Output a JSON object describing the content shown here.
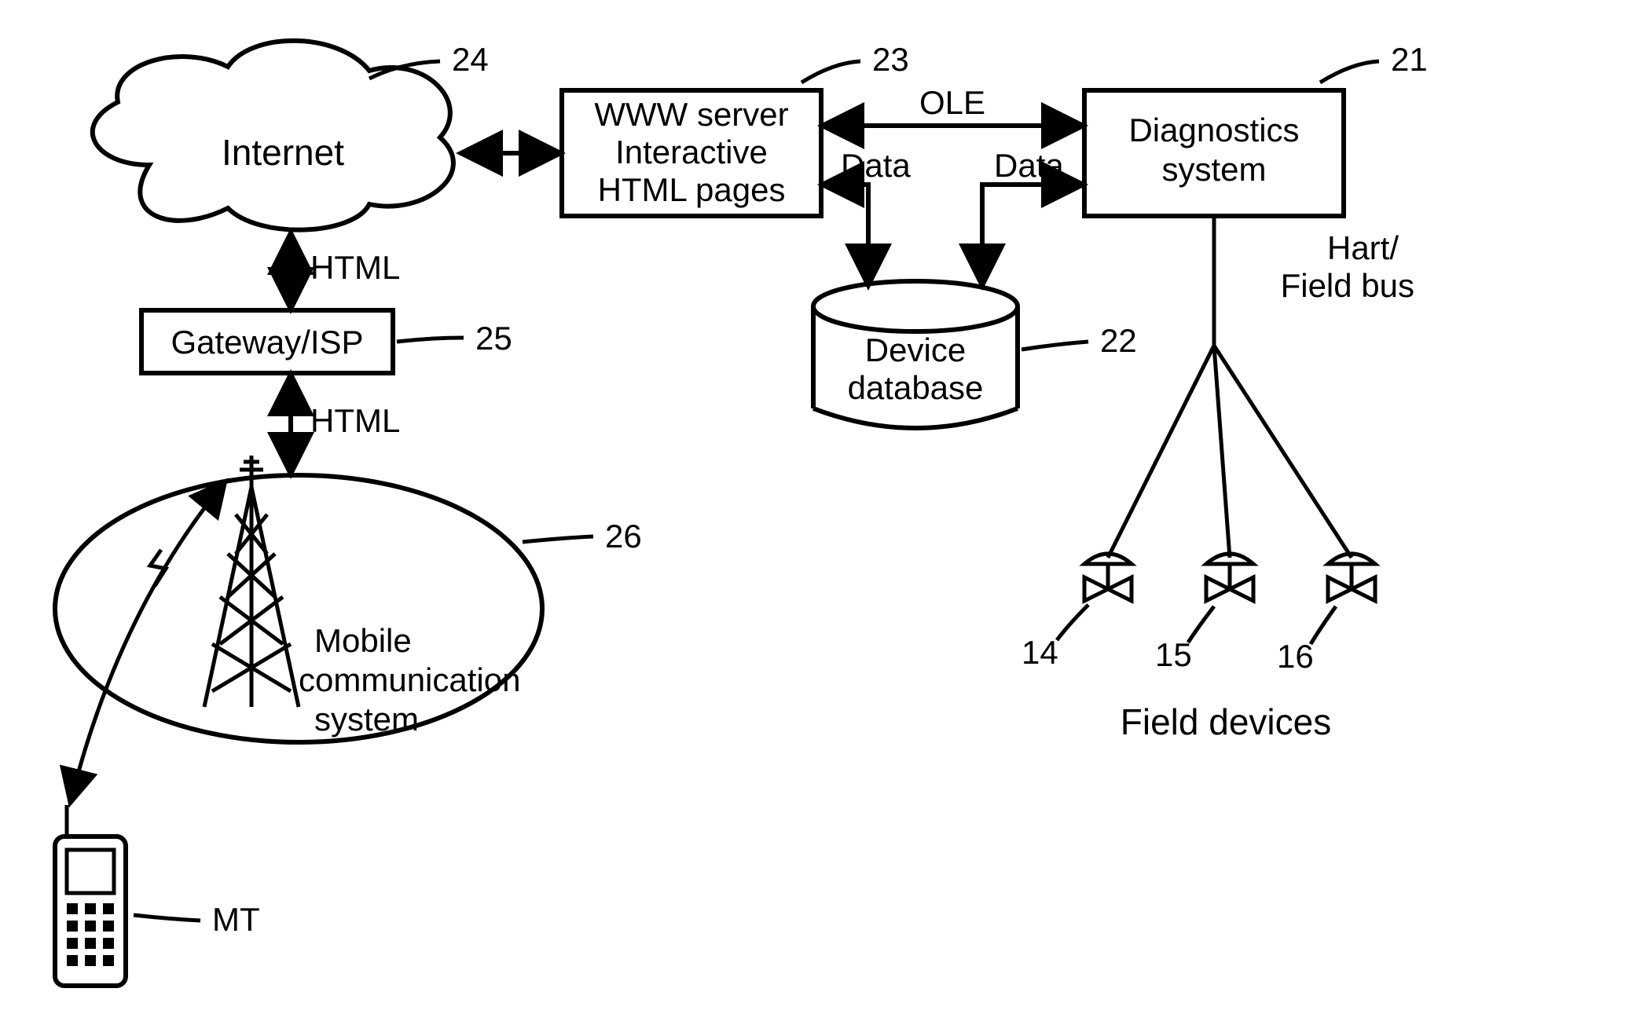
{
  "nodes": {
    "internet": {
      "label": "Internet",
      "ref": "24"
    },
    "www_server": {
      "line1": "WWW server",
      "line2": "Interactive",
      "line3": "HTML pages",
      "ref": "23"
    },
    "diagnostics": {
      "line1": "Diagnostics",
      "line2": "system",
      "ref": "21"
    },
    "gateway": {
      "label": "Gateway/ISP",
      "ref": "25"
    },
    "database": {
      "line1": "Device",
      "line2": "database",
      "ref": "22"
    },
    "mobile_system": {
      "line1": "Mobile",
      "line2": "communication",
      "line3": "system",
      "ref": "26"
    },
    "mt": {
      "label": "MT"
    }
  },
  "edges": {
    "internet_gateway": "HTML",
    "gateway_mobile": "HTML",
    "server_diag": "OLE",
    "server_db": "Data",
    "diag_db": "Data",
    "diag_bus_l1": "Hart/",
    "diag_bus_l2": "Field bus"
  },
  "field_devices": {
    "title": "Field devices",
    "dev1_ref": "14",
    "dev2_ref": "15",
    "dev3_ref": "16"
  }
}
